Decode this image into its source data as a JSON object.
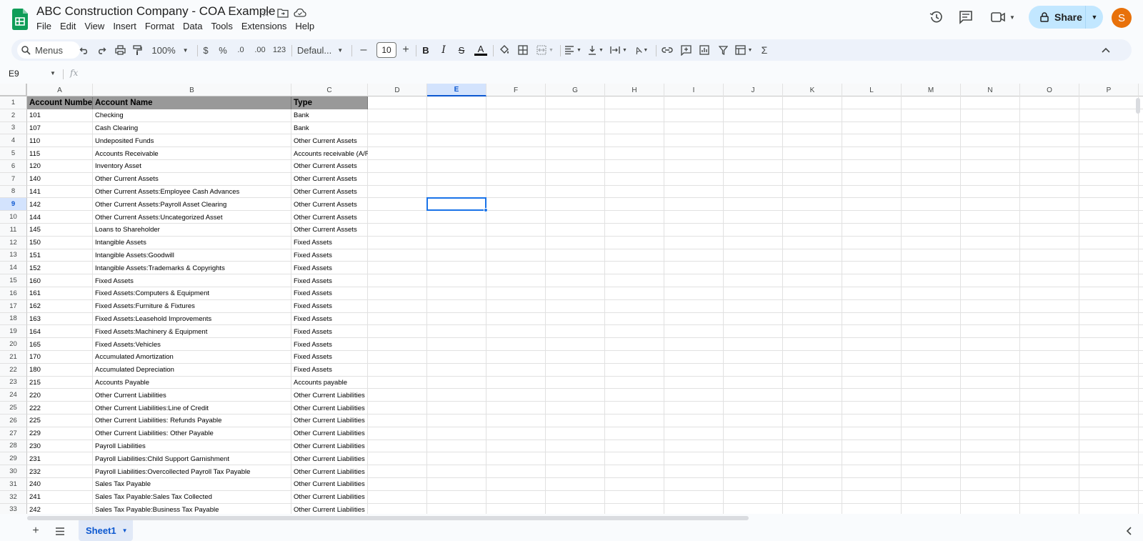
{
  "app": {
    "doc_title": "ABC Construction Company - COA Example",
    "menu": [
      "File",
      "Edit",
      "View",
      "Insert",
      "Format",
      "Data",
      "Tools",
      "Extensions",
      "Help"
    ],
    "share_label": "Share",
    "avatar_initial": "S",
    "accent_color": "#0b57d0",
    "logo_color": "#0f9d58"
  },
  "toolbar": {
    "menus_search": "Menus",
    "zoom": "100%",
    "currency": "$",
    "percent": "%",
    "decrease_decimal": ".0",
    "increase_decimal": ".00",
    "number_format": "123",
    "font": "Defaul...",
    "font_size": "10",
    "bold": "B",
    "italic": "I",
    "strike": "S",
    "text_color": "A",
    "sum": "Σ"
  },
  "formula_bar": {
    "name_box": "E9",
    "fx": "fx",
    "value": ""
  },
  "grid": {
    "columns": [
      "A",
      "B",
      "C",
      "D",
      "E",
      "F",
      "G",
      "H",
      "I",
      "J",
      "K",
      "L",
      "M",
      "N",
      "O",
      "P"
    ],
    "selected_column": "E",
    "selected_row": "9",
    "row_numbers": [
      "1",
      "2",
      "3",
      "4",
      "5",
      "6",
      "7",
      "8",
      "9",
      "10",
      "11",
      "12",
      "13",
      "14",
      "15",
      "16",
      "17",
      "18",
      "19",
      "20",
      "21",
      "22",
      "23",
      "24",
      "25",
      "26",
      "27",
      "28",
      "29",
      "30",
      "31",
      "32",
      "33"
    ],
    "header": [
      "Account Number",
      "Account Name",
      "Type"
    ],
    "rows": [
      [
        "101",
        "Checking",
        "Bank"
      ],
      [
        "107",
        "Cash Clearing",
        "Bank"
      ],
      [
        "110",
        "Undeposited Funds",
        "Other Current Assets"
      ],
      [
        "115",
        "Accounts Receivable",
        "Accounts receivable (A/R)"
      ],
      [
        "120",
        "Inventory Asset",
        "Other Current Assets"
      ],
      [
        "140",
        "Other Current Assets",
        "Other Current Assets"
      ],
      [
        "141",
        "Other Current Assets:Employee Cash Advances",
        "Other Current Assets"
      ],
      [
        "142",
        "Other Current Assets:Payroll Asset Clearing",
        "Other Current Assets"
      ],
      [
        "144",
        "Other Current Assets:Uncategorized Asset",
        "Other Current Assets"
      ],
      [
        "145",
        "Loans to Shareholder",
        "Other Current Assets"
      ],
      [
        "150",
        "Intangible Assets",
        "Fixed Assets"
      ],
      [
        "151",
        "Intangible Assets:Goodwill",
        "Fixed Assets"
      ],
      [
        "152",
        "Intangible Assets:Trademarks & Copyrights",
        "Fixed Assets"
      ],
      [
        "160",
        "Fixed Assets",
        "Fixed Assets"
      ],
      [
        "161",
        "Fixed Assets:Computers & Equipment",
        "Fixed Assets"
      ],
      [
        "162",
        "Fixed Assets:Furniture & Fixtures",
        "Fixed Assets"
      ],
      [
        "163",
        "Fixed Assets:Leasehold Improvements",
        "Fixed Assets"
      ],
      [
        "164",
        "Fixed Assets:Machinery & Equipment",
        "Fixed Assets"
      ],
      [
        "165",
        "Fixed Assets:Vehicles",
        "Fixed Assets"
      ],
      [
        "170",
        "Accumulated Amortization",
        "Fixed Assets"
      ],
      [
        "180",
        "Accumulated Depreciation",
        "Fixed Assets"
      ],
      [
        "215",
        "Accounts Payable",
        "Accounts payable"
      ],
      [
        "220",
        "Other Current Liabilities",
        "Other Current Liabilities"
      ],
      [
        "222",
        "Other Current Liabilities:Line of Credit",
        "Other Current Liabilities"
      ],
      [
        "225",
        "Other Current Liabilities: Refunds Payable",
        "Other Current Liabilities"
      ],
      [
        "229",
        "Other Current Liabilities: Other Payable",
        "Other Current Liabilities"
      ],
      [
        "230",
        "Payroll Liabilities",
        "Other Current Liabilities"
      ],
      [
        "231",
        "Payroll Liabilities:Child Support Garnishment",
        "Other Current Liabilities"
      ],
      [
        "232",
        "Payroll Liabilities:Overcollected Payroll Tax Payable",
        "Other Current Liabilities"
      ],
      [
        "240",
        "Sales Tax Payable",
        "Other Current Liabilities"
      ],
      [
        "241",
        "Sales Tax Payable:Sales Tax Collected",
        "Other Current Liabilities"
      ],
      [
        "242",
        "Sales Tax Payable:Business Tax Payable",
        "Other Current Liabilities"
      ]
    ]
  },
  "sheets": {
    "active": "Sheet1"
  }
}
